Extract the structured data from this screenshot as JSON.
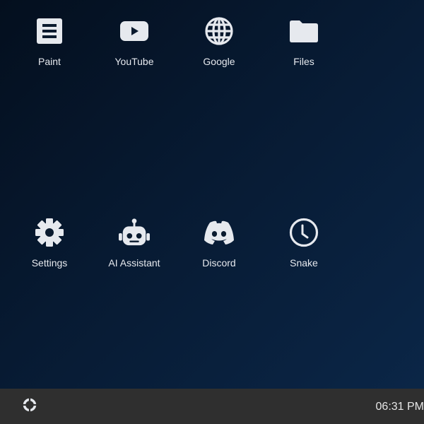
{
  "desktop": {
    "icons": [
      {
        "label": "Paint",
        "icon": "list-document-icon"
      },
      {
        "label": "YouTube",
        "icon": "youtube-play-icon"
      },
      {
        "label": "Google",
        "icon": "globe-icon"
      },
      {
        "label": "Files",
        "icon": "folder-icon"
      },
      {
        "label": "Settings",
        "icon": "gear-icon"
      },
      {
        "label": "AI Assistant",
        "icon": "robot-icon"
      },
      {
        "label": "Discord",
        "icon": "discord-icon"
      },
      {
        "label": "Snake",
        "icon": "clock-icon"
      }
    ]
  },
  "taskbar": {
    "start_icon": "start-ring-icon",
    "clock": "06:31 PM"
  },
  "colors": {
    "icon_fill": "#e6e9ee",
    "taskbar_bg": "#2f2f2f",
    "desktop_bg_dark": "#040f1e",
    "desktop_bg_light": "#0b2647"
  }
}
